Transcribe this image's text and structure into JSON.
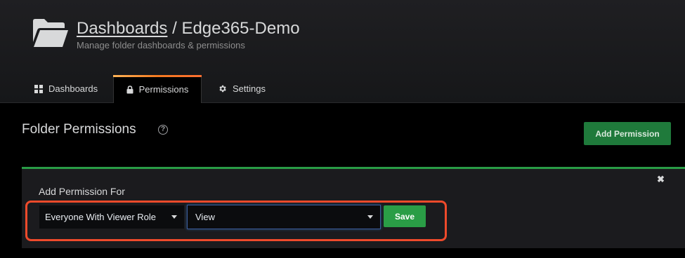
{
  "header": {
    "breadcrumb_link": "Dashboards",
    "separator": " / ",
    "folder_name": "Edge365-Demo",
    "subtitle": "Manage folder dashboards & permissions",
    "icon": "folder-open-icon"
  },
  "tabs": [
    {
      "label": "Dashboards",
      "icon": "grid-icon",
      "active": false
    },
    {
      "label": "Permissions",
      "icon": "lock-icon",
      "active": true
    },
    {
      "label": "Settings",
      "icon": "gear-icon",
      "active": false
    }
  ],
  "permissions": {
    "title": "Folder Permissions",
    "help_icon": "?",
    "add_button": "Add Permission"
  },
  "add_panel": {
    "label": "Add Permission For",
    "close_icon": "✖",
    "role_select": "Everyone With Viewer Role",
    "permission_select": "View",
    "save_button": "Save"
  },
  "colors": {
    "accent_green": "#299c46",
    "highlight": "#ee4a2b",
    "tab_gradient": "#f47a20"
  }
}
